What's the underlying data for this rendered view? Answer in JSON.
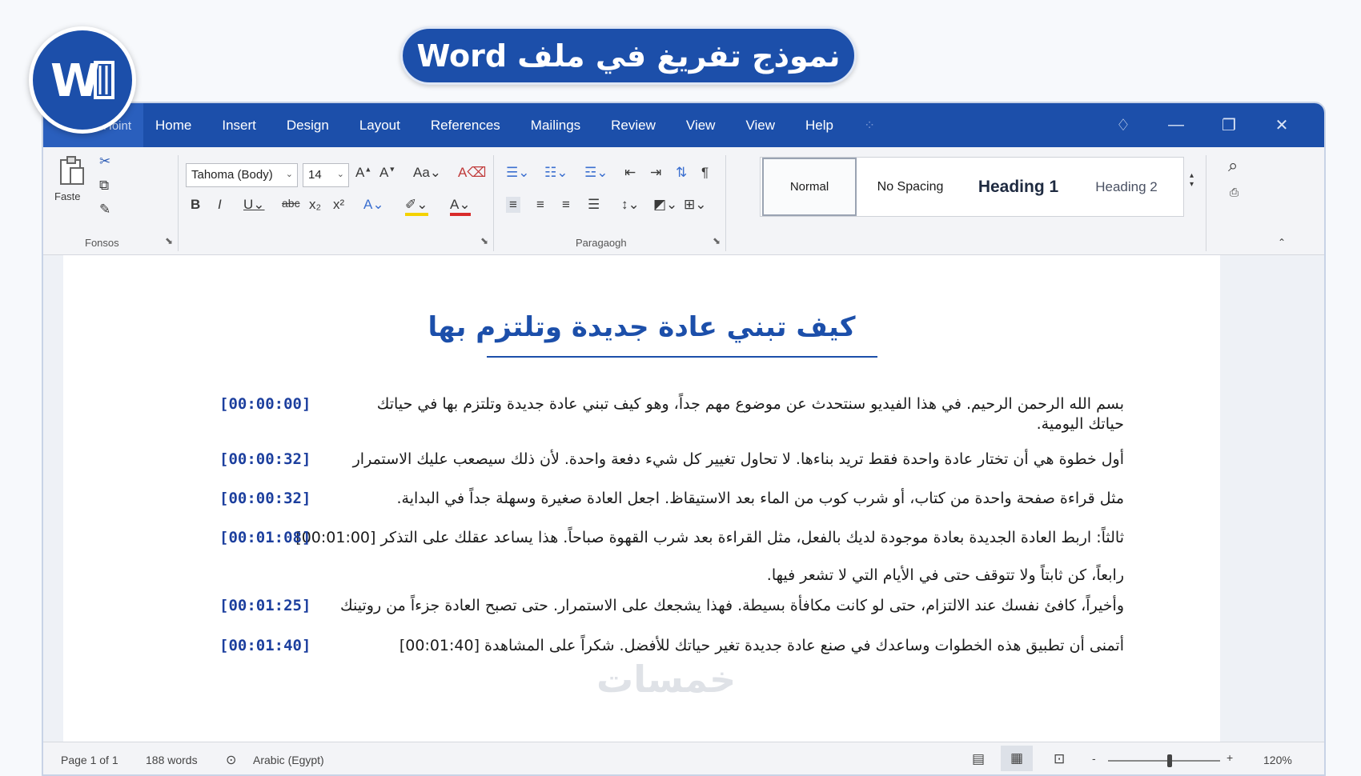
{
  "banner": {
    "title": "نموذج تفريغ في ملف Word"
  },
  "logo": {
    "letter": "W"
  },
  "titlebar": {
    "file_tab": "Hoint",
    "tabs": [
      "Home",
      "Insert",
      "Design",
      "Layout",
      "References",
      "Mailings",
      "Review",
      "View",
      "View",
      "Help"
    ]
  },
  "ribbon": {
    "clipboard": {
      "paste_label": "Faste",
      "group_label": "Fonsos"
    },
    "font": {
      "name": "Tahoma (Body)",
      "size": "14"
    },
    "paragraph": {
      "group_label": "Paragaogh"
    },
    "styles": [
      "Normal",
      "No Spacing",
      "Heading 1",
      "Heading 2"
    ]
  },
  "document": {
    "title": "كيف تبني عادة جديدة وتلتزم بها",
    "lines": [
      {
        "timestamp": "[00:00:00]",
        "text": "بسم الله الرحمن الرحيم. في هذا الفيديو سنتحدث عن موضوع مهم جداً، وهو كيف تبني عادة جديدة وتلتزم بها في حياتك",
        "cont": "حياتك اليومية."
      },
      {
        "timestamp": "[00:00:32]",
        "text": "أول خطوة هي أن تختار عادة واحدة فقط تريد بناءها. لا تحاول تغيير كل شيء دفعة واحدة. لأن ذلك سيصعب عليك الاستمرار"
      },
      {
        "timestamp": "[00:00:32]",
        "text": "مثل قراءة صفحة واحدة من كتاب، أو شرب كوب من الماء بعد الاستيقاظ. اجعل العادة صغيرة وسهلة جداً في البداية."
      },
      {
        "timestamp": "[00:01:08]",
        "text": "ثالثاً: اربط العادة الجديدة بعادة موجودة لديك بالفعل، مثل القراءة بعد شرب القهوة صباحاً. هذا يساعد عقلك على التذكر [00:01:00]"
      },
      {
        "timestamp": "",
        "text": "رابعاً، كن ثابتاً ولا تتوقف حتى في الأيام التي لا تشعر فيها."
      },
      {
        "timestamp": "[00:01:25]",
        "text": "وأخيراً، كافئ نفسك عند الالتزام، حتى لو كانت مكافأة بسيطة. فهذا يشجعك على الاستمرار. حتى تصبح العادة جزءاً من روتينك"
      },
      {
        "timestamp": "[00:01:40]",
        "text": "أتمنى أن تطبيق هذه الخطوات وساعدك في صنع عادة جديدة تغير حياتك للأفضل. شكراً على المشاهدة [00:01:40]"
      }
    ]
  },
  "status": {
    "page": "Page 1 of 1",
    "words": "188 words",
    "language": "Arabic (Egypt)",
    "zoom": "120%",
    "zoom_level": 0.55
  },
  "watermark": "خمسات",
  "colors": {
    "accent": "#1c4faa",
    "timestamp": "#1c3f9e"
  }
}
